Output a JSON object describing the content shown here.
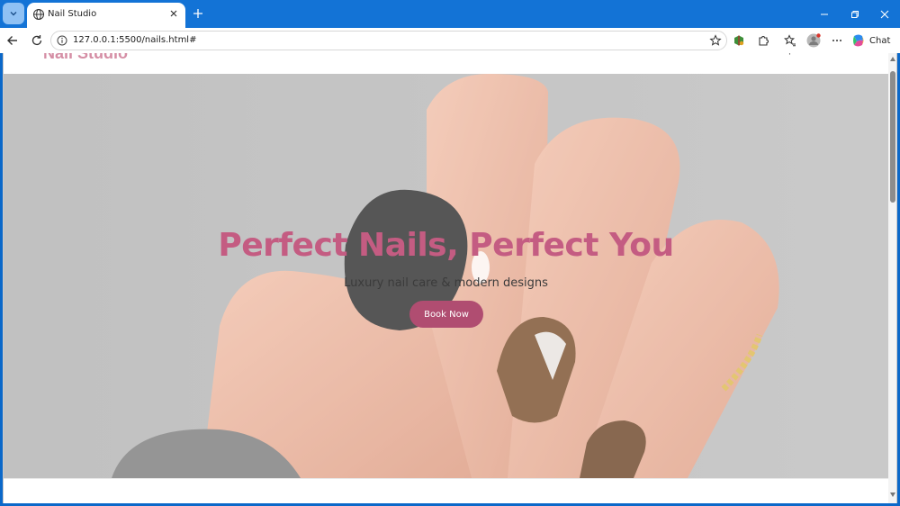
{
  "browser": {
    "tab_title": "Nail Studio",
    "url": "127.0.0.1:5500/nails.html#",
    "chat_label": "Chat",
    "icons": {
      "tab_menu": "chevron-down-icon",
      "tab_favicon": "globe-icon",
      "tab_close": "close-icon",
      "new_tab": "plus-icon",
      "minimize": "minimize-icon",
      "restore": "restore-icon",
      "close_window": "close-icon",
      "back": "back-arrow-icon",
      "reload": "reload-icon",
      "site_info": "info-icon",
      "favorite": "star-icon",
      "extension_green": "extension-icon",
      "extensions": "puzzle-icon",
      "favorites": "favorites-icon",
      "profile": "avatar-icon",
      "more": "more-icon",
      "copilot": "copilot-icon"
    },
    "colors": {
      "frame": "#1373d6",
      "accent": "#0b68c9"
    }
  },
  "site": {
    "logo": "Nail Studio",
    "hero": {
      "title": "Perfect Nails, Perfect You",
      "subtitle": "Luxury nail care & modern designs",
      "cta": "Book Now"
    },
    "colors": {
      "logo": "#d58ea5",
      "title": "#c45c82",
      "button": "#b04d71"
    }
  }
}
